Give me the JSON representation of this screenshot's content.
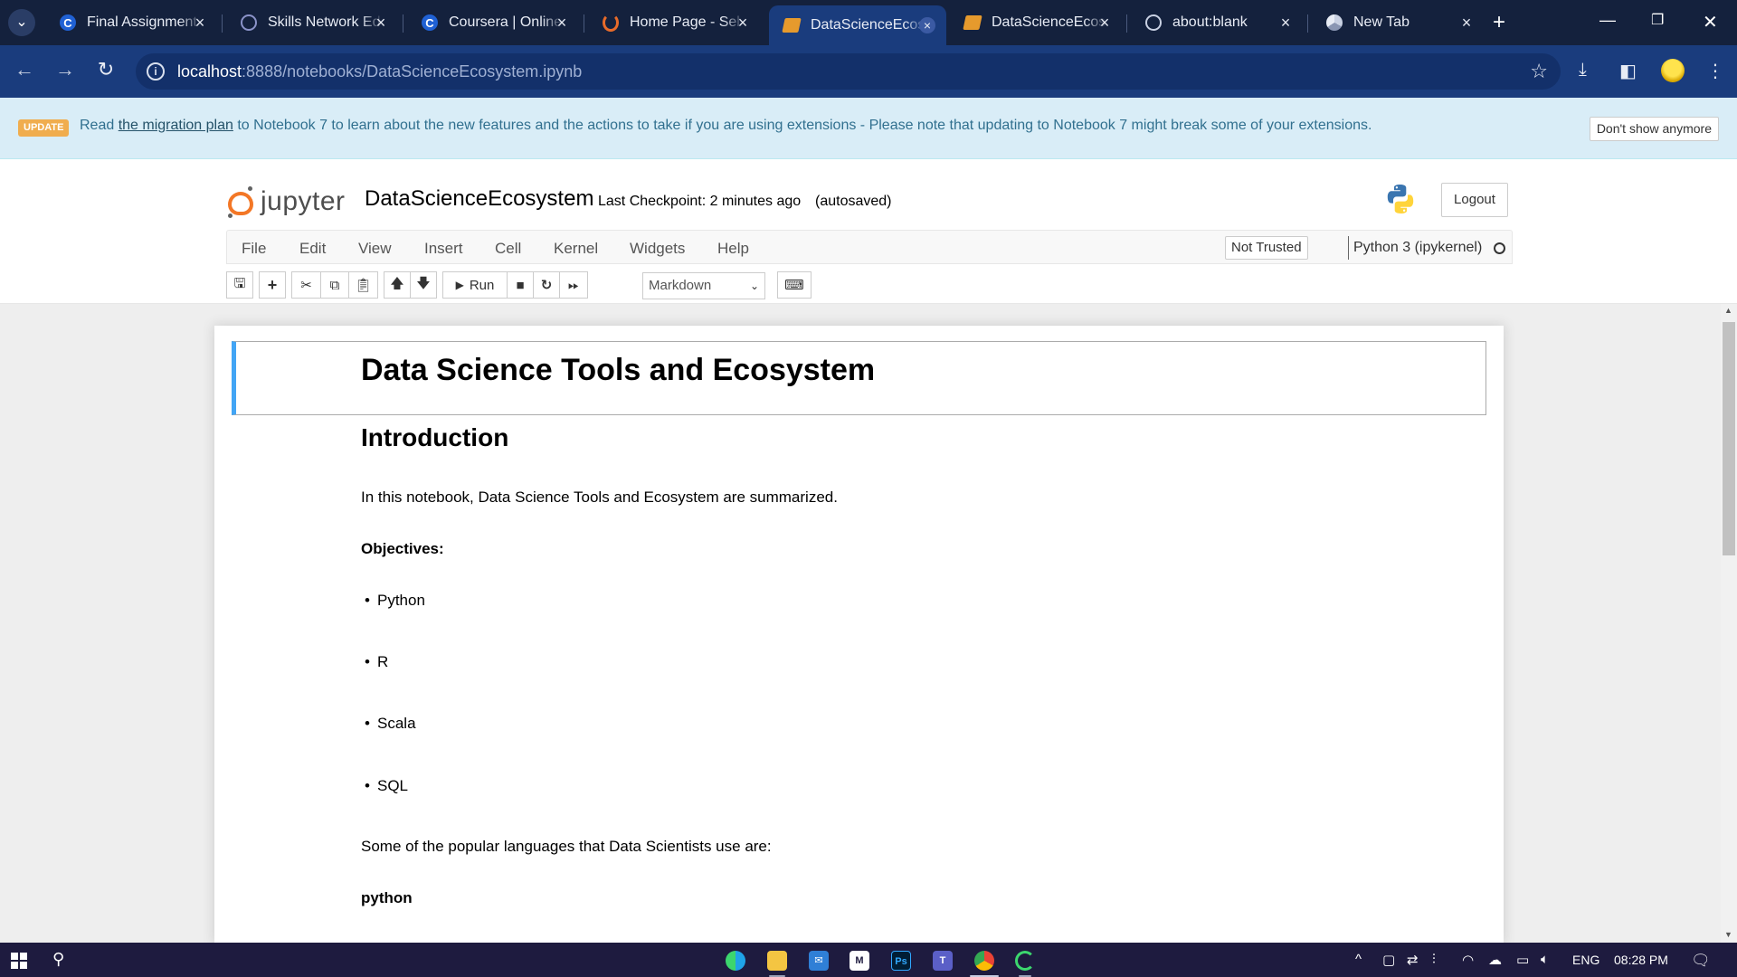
{
  "browser": {
    "tabs": [
      {
        "title": "Final Assignment",
        "favicon": "coursera-icon"
      },
      {
        "title": "Skills Network Ed",
        "favicon": "skills-network-icon"
      },
      {
        "title": "Coursera | Online",
        "favicon": "coursera-icon"
      },
      {
        "title": "Home Page - Sel",
        "favicon": "jupyter-home-icon"
      },
      {
        "title": "DataScienceEcos",
        "favicon": "notebook-icon",
        "active": true
      },
      {
        "title": "DataScienceEcos",
        "favicon": "notebook-icon"
      },
      {
        "title": "about:blank",
        "favicon": "globe-icon"
      },
      {
        "title": "New Tab",
        "favicon": "chrome-icon"
      }
    ],
    "url_host": "localhost",
    "url_rest": ":8888/notebooks/DataScienceEcosystem.ipynb"
  },
  "banner": {
    "badge": "UPDATE",
    "read": "Read",
    "link": "the migration plan",
    "text": "to Notebook 7 to learn about the new features and the actions to take if you are using extensions - Please note that updating to Notebook 7 might break some of your extensions.",
    "dismiss": "Don't show anymore"
  },
  "header": {
    "logo_text": "jupyter",
    "notebook_name": "DataScienceEcosystem",
    "checkpoint": "Last Checkpoint: 2 minutes ago",
    "autosave": "(autosaved)",
    "logout": "Logout"
  },
  "menu": {
    "items": [
      "File",
      "Edit",
      "View",
      "Insert",
      "Cell",
      "Kernel",
      "Widgets",
      "Help"
    ],
    "trusted": "Not Trusted",
    "kernel": "Python 3 (ipykernel)"
  },
  "toolbar": {
    "run": "Run",
    "cell_type": "Markdown"
  },
  "notebook": {
    "title": "Data Science Tools and Ecosystem",
    "intro_heading": "Introduction",
    "intro_text": "In this notebook, Data Science Tools and Ecosystem are summarized.",
    "objectives_label": "Objectives:",
    "objectives": [
      "Python",
      "R",
      "Scala",
      "SQL"
    ],
    "languages_intro": "Some of the popular languages that Data Scientists use are:",
    "first_language": "python"
  },
  "taskbar": {
    "lang": "ENG",
    "time": "08:28 PM"
  }
}
